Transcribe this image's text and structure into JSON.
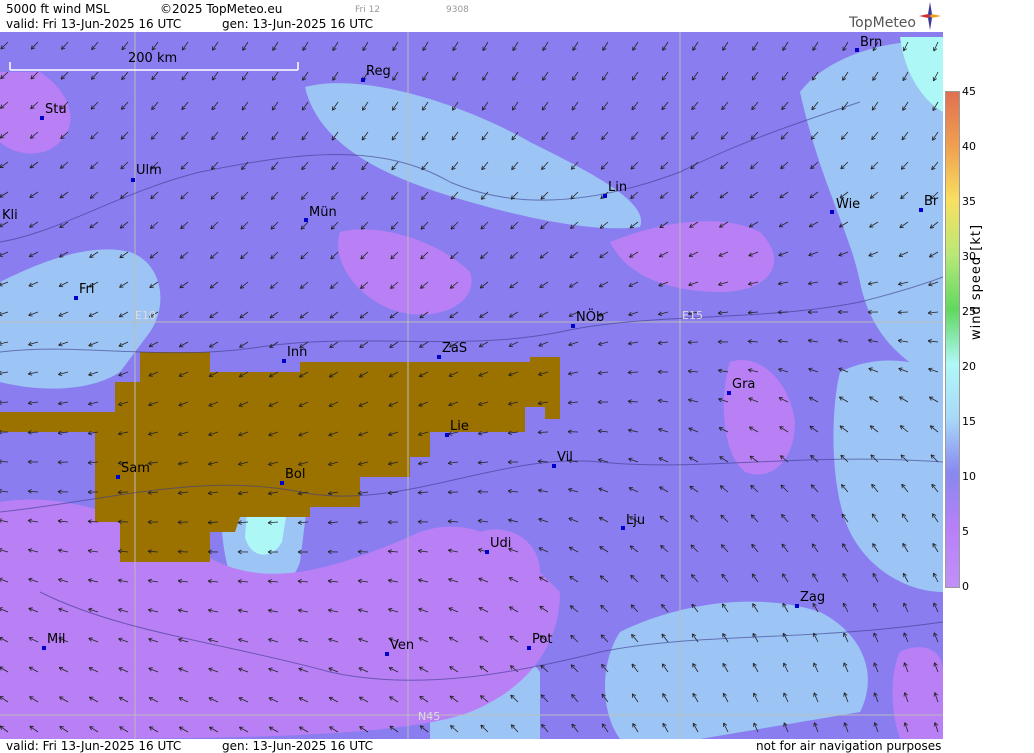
{
  "header": {
    "product": "5000 ft wind MSL",
    "copyright": "©2025 TopMeteo.eu",
    "frame": "Fri 12",
    "code": "9308",
    "valid": "valid:  Fri  13-Jun-2025  16 UTC",
    "gen": "gen: 13-Jun-2025 16 UTC",
    "logo_text": "TopMeteo"
  },
  "footer": {
    "valid": "valid:  Fri  13-Jun-2025  16 UTC",
    "gen": "gen: 13-Jun-2025 16 UTC",
    "disclaimer": "not for air navigation purposes"
  },
  "map": {
    "scale_label": "200 km",
    "grid_labels": [
      "E10",
      "E15",
      "N45"
    ],
    "cities": [
      "Brn",
      "Reg",
      "Stu",
      "Ulm",
      "Lin",
      "Mün",
      "Wie",
      "Br",
      "Kli",
      "Fri",
      "NÖb",
      "ZaS",
      "Inn",
      "Gra",
      "Lie",
      "Vil",
      "Sam",
      "Bol",
      "Lju",
      "Udi",
      "Zag",
      "Mil",
      "Pot",
      "Ven"
    ]
  },
  "legend": {
    "title": "wind speed [kt]",
    "ticks": [
      "45",
      "40",
      "35",
      "30",
      "25",
      "20",
      "15",
      "10",
      "5",
      "0"
    ],
    "colors": [
      "#e07050",
      "#f0a050",
      "#f8e060",
      "#b8e878",
      "#60d860",
      "#b0f8f8",
      "#a8d8f8",
      "#8888f0",
      "#b880f8"
    ]
  },
  "colors": {
    "base": "#8a7df0",
    "light_blue": "#9cc4f4",
    "cyan": "#aef7f7",
    "purple": "#b97ff5",
    "terrain": "#9b7200"
  }
}
